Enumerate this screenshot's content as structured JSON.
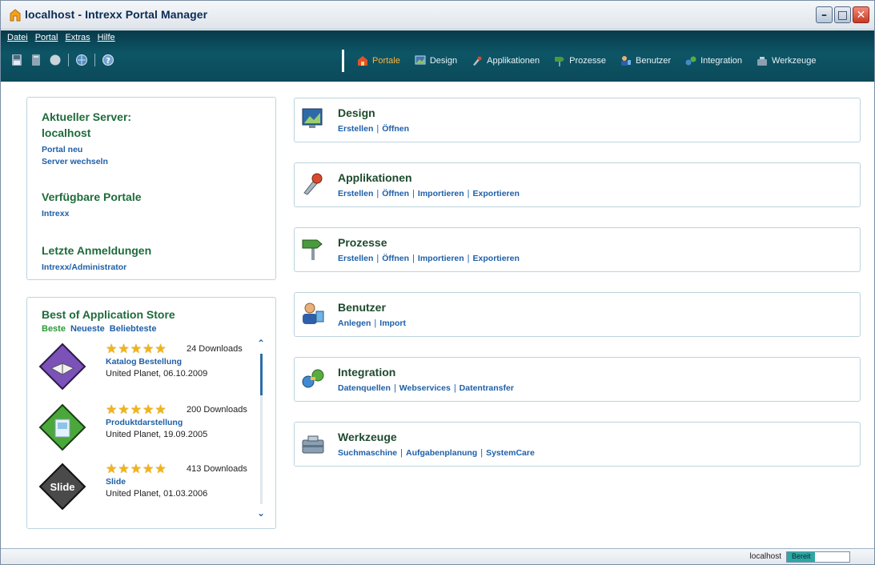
{
  "window": {
    "title": "localhost - Intrexx Portal Manager"
  },
  "menu": [
    "Datei",
    "Portal",
    "Extras",
    "Hilfe"
  ],
  "toolbar": {
    "icons": [
      "save-icon",
      "book-icon",
      "circle-icon",
      "globe-icon",
      "help-icon"
    ]
  },
  "tabs": [
    {
      "label": "Portale",
      "icon": "portal-icon",
      "active": true
    },
    {
      "label": "Design",
      "icon": "design-icon"
    },
    {
      "label": "Applikationen",
      "icon": "applications-icon"
    },
    {
      "label": "Prozesse",
      "icon": "processes-icon"
    },
    {
      "label": "Benutzer",
      "icon": "users-icon"
    },
    {
      "label": "Integration",
      "icon": "integration-icon"
    },
    {
      "label": "Werkzeuge",
      "icon": "tools-icon"
    }
  ],
  "server": {
    "heading": "Aktueller Server:",
    "name": "localhost",
    "link_new_portal": "Portal neu",
    "link_switch_server": "Server wechseln",
    "portals_heading": "Verfügbare Portale",
    "portals": [
      "Intrexx"
    ],
    "logins_heading": "Letzte Anmeldungen",
    "logins": [
      "Intrexx/Administrator"
    ]
  },
  "store": {
    "heading": "Best of Application Store",
    "tabs": [
      {
        "label": "Beste",
        "active": true
      },
      {
        "label": "Neueste"
      },
      {
        "label": "Beliebteste"
      }
    ],
    "items": [
      {
        "downloads": "24 Downloads",
        "name": "Katalog Bestellung",
        "meta": "United Planet, 06.10.2009",
        "stars": 5
      },
      {
        "downloads": "200 Downloads",
        "name": "Produktdarstellung",
        "meta": "United Planet, 19.09.2005",
        "stars": 5
      },
      {
        "downloads": "413 Downloads",
        "name": "Slide",
        "meta": "United Planet, 01.03.2006",
        "stars": 5,
        "logo_text": "Slide"
      }
    ]
  },
  "cards": [
    {
      "title": "Design",
      "icon": "design-icon",
      "links": [
        "Erstellen",
        "Öffnen"
      ]
    },
    {
      "title": "Applikationen",
      "icon": "applications-icon",
      "links": [
        "Erstellen",
        "Öffnen",
        "Importieren",
        "Exportieren"
      ]
    },
    {
      "title": "Prozesse",
      "icon": "processes-icon",
      "links": [
        "Erstellen",
        "Öffnen",
        "Importieren",
        "Exportieren"
      ]
    },
    {
      "title": "Benutzer",
      "icon": "users-icon",
      "links": [
        "Anlegen",
        "Import"
      ]
    },
    {
      "title": "Integration",
      "icon": "integration-icon",
      "links": [
        "Datenquellen",
        "Webservices",
        "Datentransfer"
      ]
    },
    {
      "title": "Werkzeuge",
      "icon": "tools-icon",
      "links": [
        "Suchmaschine",
        "Aufgabenplanung",
        "SystemCare"
      ]
    }
  ],
  "status": {
    "host": "localhost",
    "progress_label": "Bereit",
    "progress": 0.45
  },
  "colors": {
    "accent": "#ffb43a",
    "link": "#1e5fa8",
    "heading": "#1e6b3b",
    "strip": "#0d5566"
  }
}
